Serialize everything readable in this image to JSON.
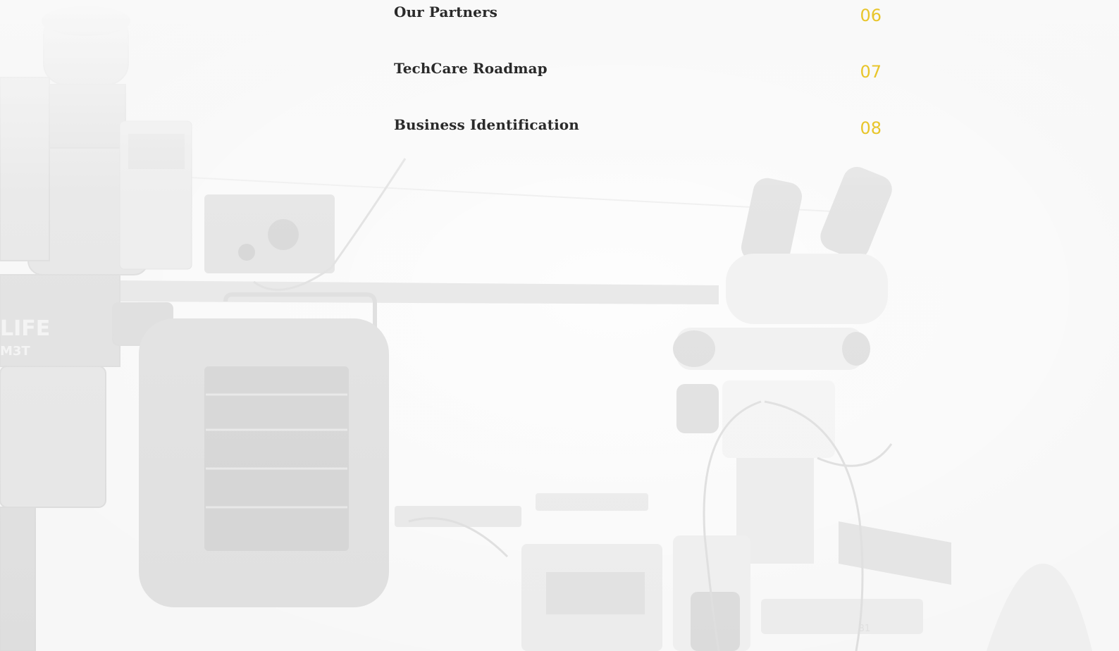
{
  "toc": {
    "items": [
      {
        "label": "Our Partners",
        "number": "06"
      },
      {
        "label": "TechCare Roadmap",
        "number": "07"
      },
      {
        "label": "Business Identification",
        "number": "08"
      }
    ]
  },
  "background": {
    "icon": "workbench-microscopes-photo",
    "lettering": [
      "LIFE",
      "M3T",
      "B1"
    ]
  },
  "colors": {
    "accent": "#e8c52a",
    "text": "#2a2a2a",
    "background": "#f4f4f4"
  }
}
